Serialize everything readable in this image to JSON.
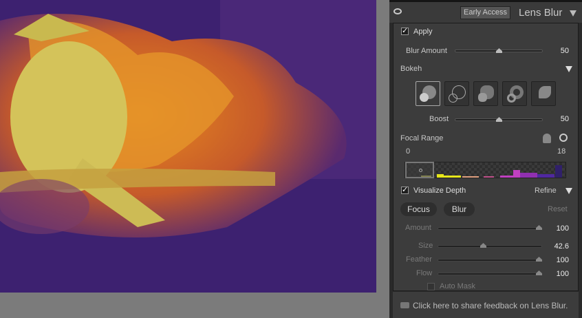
{
  "header": {
    "badge": "Early Access",
    "title": "Lens Blur"
  },
  "apply": {
    "label": "Apply",
    "checked": true
  },
  "blur_amount": {
    "label": "Blur Amount",
    "value": "50"
  },
  "bokeh": {
    "label": "Bokeh",
    "shapes": [
      "bokeh-circle",
      "bokeh-bubble",
      "bokeh-blade",
      "bokeh-ring",
      "bokeh-cat-eye"
    ],
    "selected": 0
  },
  "boost": {
    "label": "Boost",
    "value": "50"
  },
  "focal_range": {
    "label": "Focal Range",
    "min": "0",
    "max": "18"
  },
  "visualize": {
    "label": "Visualize Depth",
    "checked": true,
    "refine": "Refine"
  },
  "refine_tabs": {
    "focus": "Focus",
    "blur": "Blur",
    "reset": "Reset"
  },
  "brush": {
    "amount": {
      "label": "Amount",
      "value": "100"
    },
    "size": {
      "label": "Size",
      "value": "42.6"
    },
    "feather": {
      "label": "Feather",
      "value": "100"
    },
    "flow": {
      "label": "Flow",
      "value": "100"
    },
    "auto_mask": "Auto Mask"
  },
  "feedback": "Click here to share feedback on Lens Blur."
}
